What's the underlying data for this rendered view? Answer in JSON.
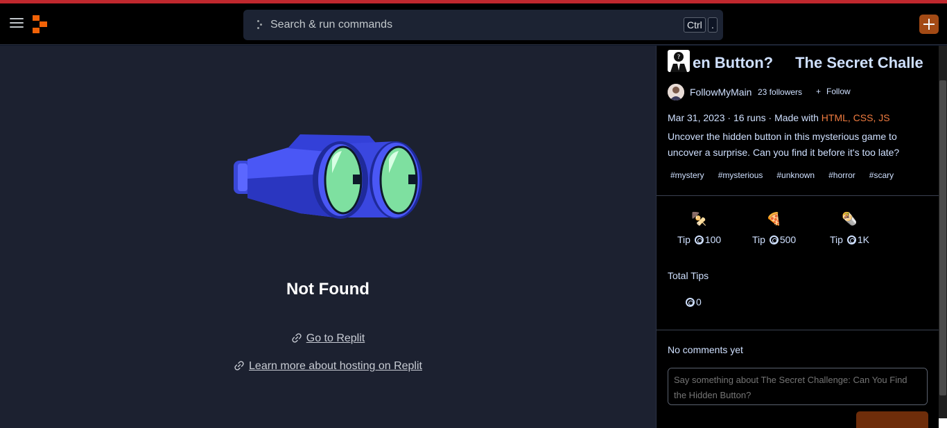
{
  "topbar": {
    "search_placeholder": "Search & run commands",
    "kbd_ctrl": "Ctrl",
    "kbd_dot": "."
  },
  "main": {
    "title": "Not Found",
    "go_link": "Go to Replit",
    "learn_link": "Learn more about hosting on Replit"
  },
  "panel": {
    "marquee_a": "en Button?",
    "marquee_b": "The Secret Challe",
    "author": "FollowMyMain",
    "followers": "23 followers",
    "follow": "Follow",
    "meta_prefix": "Mar 31, 2023 · 16 runs · Made with ",
    "tech": "HTML, CSS, JS",
    "description": "Uncover the hidden button in this mysterious game to uncover a surprise. Can you find it before it's too late?",
    "tags": [
      "#mystery",
      "#mysterious",
      "#unknown",
      "#horror",
      "#scary"
    ],
    "tips": [
      {
        "emoji": "🍢",
        "label": "Tip",
        "amount": "100"
      },
      {
        "emoji": "🍕",
        "label": "Tip",
        "amount": "500"
      },
      {
        "emoji": "🌯",
        "label": "Tip",
        "amount": "1K"
      }
    ],
    "total_tips_label": "Total Tips",
    "total_tips_value": "0",
    "no_comments": "No comments yet",
    "comment_placeholder": "Say something about The Secret Challenge: Can You Find the Hidden Button?"
  },
  "colors": {
    "accent": "#f26207",
    "tech_link": "#f07b3f",
    "binocular_blue": "#4a57f5",
    "lens_green": "#7ee0a0"
  }
}
